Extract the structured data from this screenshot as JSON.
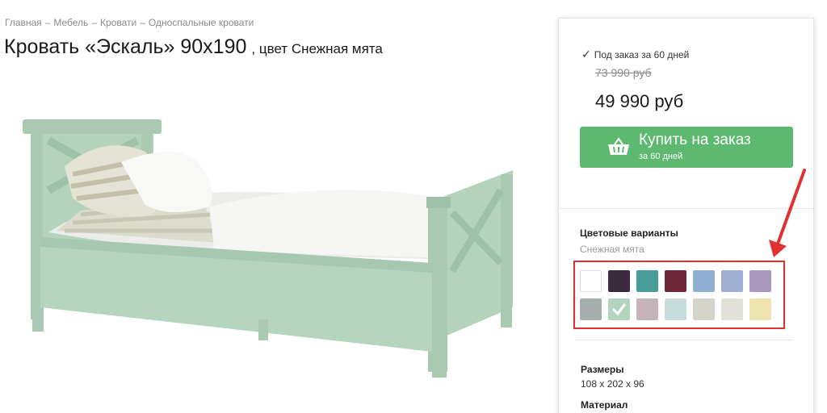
{
  "breadcrumb": [
    "Главная",
    "Мебель",
    "Кровати",
    "Односпальные кровати"
  ],
  "breadcrumb_sep": "–",
  "title": {
    "main": "Кровать «Эскаль» 90х190",
    "sub": ", цвет Снежная мята"
  },
  "availability": "Под заказ за 60 дней",
  "price": {
    "old": "73 990 руб",
    "new": "49 990 руб"
  },
  "buy_button": {
    "label": "Купить на заказ",
    "sublabel": "за 60 дней"
  },
  "colors": {
    "title": "Цветовые варианты",
    "current": "Снежная мята",
    "swatches": [
      "#ffffff",
      "#3b2a3d",
      "#4a9e9a",
      "#6e2639",
      "#8fb0d0",
      "#9db0d4",
      "#a897bf",
      "#a6afae",
      "#b2d3bd",
      "#c5b3b7",
      "#c7dcdd",
      "#d4d4ca",
      "#e1e1da",
      "#efe3b0"
    ],
    "selected_index": 8
  },
  "specs": [
    {
      "label": "Размеры",
      "value": "108 х 202 х 96"
    },
    {
      "label": "Материал",
      "value": ""
    }
  ],
  "accent_colors": {
    "buy": "#5cb96f",
    "highlight": "#e03131",
    "bed": "#b4d3bd"
  },
  "icons": {
    "check": "check-icon",
    "cart": "shopping-basket-icon",
    "annotation": "red-arrow-icon"
  }
}
